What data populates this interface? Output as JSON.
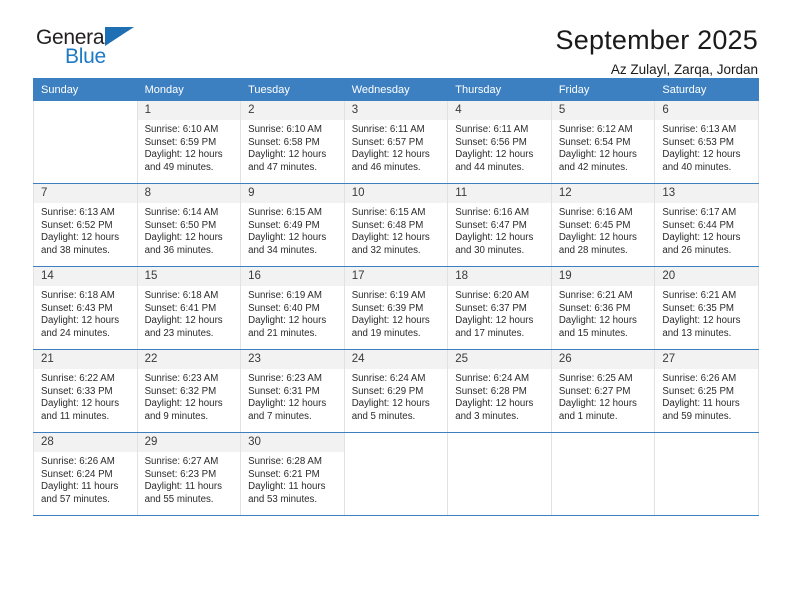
{
  "brand": {
    "name_dark": "General",
    "name_blue": "Blue",
    "accent_color": "#1f7ac4",
    "header_color": "#3d80c2"
  },
  "header": {
    "title": "September 2025",
    "location": "Az Zulayl, Zarqa, Jordan"
  },
  "weekdays": [
    "Sunday",
    "Monday",
    "Tuesday",
    "Wednesday",
    "Thursday",
    "Friday",
    "Saturday"
  ],
  "weeks": [
    [
      {
        "day": "",
        "lines": []
      },
      {
        "day": "1",
        "lines": [
          "Sunrise: 6:10 AM",
          "Sunset: 6:59 PM",
          "Daylight: 12 hours",
          "and 49 minutes."
        ]
      },
      {
        "day": "2",
        "lines": [
          "Sunrise: 6:10 AM",
          "Sunset: 6:58 PM",
          "Daylight: 12 hours",
          "and 47 minutes."
        ]
      },
      {
        "day": "3",
        "lines": [
          "Sunrise: 6:11 AM",
          "Sunset: 6:57 PM",
          "Daylight: 12 hours",
          "and 46 minutes."
        ]
      },
      {
        "day": "4",
        "lines": [
          "Sunrise: 6:11 AM",
          "Sunset: 6:56 PM",
          "Daylight: 12 hours",
          "and 44 minutes."
        ]
      },
      {
        "day": "5",
        "lines": [
          "Sunrise: 6:12 AM",
          "Sunset: 6:54 PM",
          "Daylight: 12 hours",
          "and 42 minutes."
        ]
      },
      {
        "day": "6",
        "lines": [
          "Sunrise: 6:13 AM",
          "Sunset: 6:53 PM",
          "Daylight: 12 hours",
          "and 40 minutes."
        ]
      }
    ],
    [
      {
        "day": "7",
        "lines": [
          "Sunrise: 6:13 AM",
          "Sunset: 6:52 PM",
          "Daylight: 12 hours",
          "and 38 minutes."
        ]
      },
      {
        "day": "8",
        "lines": [
          "Sunrise: 6:14 AM",
          "Sunset: 6:50 PM",
          "Daylight: 12 hours",
          "and 36 minutes."
        ]
      },
      {
        "day": "9",
        "lines": [
          "Sunrise: 6:15 AM",
          "Sunset: 6:49 PM",
          "Daylight: 12 hours",
          "and 34 minutes."
        ]
      },
      {
        "day": "10",
        "lines": [
          "Sunrise: 6:15 AM",
          "Sunset: 6:48 PM",
          "Daylight: 12 hours",
          "and 32 minutes."
        ]
      },
      {
        "day": "11",
        "lines": [
          "Sunrise: 6:16 AM",
          "Sunset: 6:47 PM",
          "Daylight: 12 hours",
          "and 30 minutes."
        ]
      },
      {
        "day": "12",
        "lines": [
          "Sunrise: 6:16 AM",
          "Sunset: 6:45 PM",
          "Daylight: 12 hours",
          "and 28 minutes."
        ]
      },
      {
        "day": "13",
        "lines": [
          "Sunrise: 6:17 AM",
          "Sunset: 6:44 PM",
          "Daylight: 12 hours",
          "and 26 minutes."
        ]
      }
    ],
    [
      {
        "day": "14",
        "lines": [
          "Sunrise: 6:18 AM",
          "Sunset: 6:43 PM",
          "Daylight: 12 hours",
          "and 24 minutes."
        ]
      },
      {
        "day": "15",
        "lines": [
          "Sunrise: 6:18 AM",
          "Sunset: 6:41 PM",
          "Daylight: 12 hours",
          "and 23 minutes."
        ]
      },
      {
        "day": "16",
        "lines": [
          "Sunrise: 6:19 AM",
          "Sunset: 6:40 PM",
          "Daylight: 12 hours",
          "and 21 minutes."
        ]
      },
      {
        "day": "17",
        "lines": [
          "Sunrise: 6:19 AM",
          "Sunset: 6:39 PM",
          "Daylight: 12 hours",
          "and 19 minutes."
        ]
      },
      {
        "day": "18",
        "lines": [
          "Sunrise: 6:20 AM",
          "Sunset: 6:37 PM",
          "Daylight: 12 hours",
          "and 17 minutes."
        ]
      },
      {
        "day": "19",
        "lines": [
          "Sunrise: 6:21 AM",
          "Sunset: 6:36 PM",
          "Daylight: 12 hours",
          "and 15 minutes."
        ]
      },
      {
        "day": "20",
        "lines": [
          "Sunrise: 6:21 AM",
          "Sunset: 6:35 PM",
          "Daylight: 12 hours",
          "and 13 minutes."
        ]
      }
    ],
    [
      {
        "day": "21",
        "lines": [
          "Sunrise: 6:22 AM",
          "Sunset: 6:33 PM",
          "Daylight: 12 hours",
          "and 11 minutes."
        ]
      },
      {
        "day": "22",
        "lines": [
          "Sunrise: 6:23 AM",
          "Sunset: 6:32 PM",
          "Daylight: 12 hours",
          "and 9 minutes."
        ]
      },
      {
        "day": "23",
        "lines": [
          "Sunrise: 6:23 AM",
          "Sunset: 6:31 PM",
          "Daylight: 12 hours",
          "and 7 minutes."
        ]
      },
      {
        "day": "24",
        "lines": [
          "Sunrise: 6:24 AM",
          "Sunset: 6:29 PM",
          "Daylight: 12 hours",
          "and 5 minutes."
        ]
      },
      {
        "day": "25",
        "lines": [
          "Sunrise: 6:24 AM",
          "Sunset: 6:28 PM",
          "Daylight: 12 hours",
          "and 3 minutes."
        ]
      },
      {
        "day": "26",
        "lines": [
          "Sunrise: 6:25 AM",
          "Sunset: 6:27 PM",
          "Daylight: 12 hours",
          "and 1 minute."
        ]
      },
      {
        "day": "27",
        "lines": [
          "Sunrise: 6:26 AM",
          "Sunset: 6:25 PM",
          "Daylight: 11 hours",
          "and 59 minutes."
        ]
      }
    ],
    [
      {
        "day": "28",
        "lines": [
          "Sunrise: 6:26 AM",
          "Sunset: 6:24 PM",
          "Daylight: 11 hours",
          "and 57 minutes."
        ]
      },
      {
        "day": "29",
        "lines": [
          "Sunrise: 6:27 AM",
          "Sunset: 6:23 PM",
          "Daylight: 11 hours",
          "and 55 minutes."
        ]
      },
      {
        "day": "30",
        "lines": [
          "Sunrise: 6:28 AM",
          "Sunset: 6:21 PM",
          "Daylight: 11 hours",
          "and 53 minutes."
        ]
      },
      {
        "day": "",
        "lines": []
      },
      {
        "day": "",
        "lines": []
      },
      {
        "day": "",
        "lines": []
      },
      {
        "day": "",
        "lines": []
      }
    ]
  ]
}
